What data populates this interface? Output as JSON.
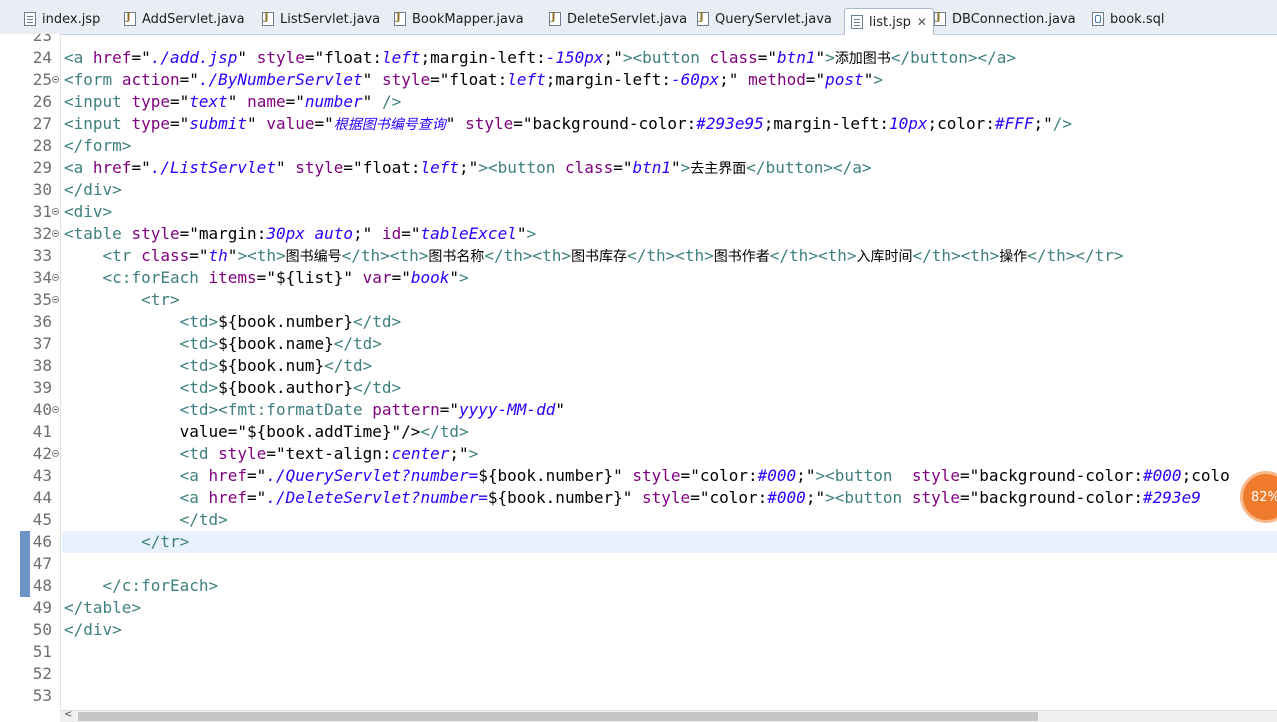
{
  "tabs": [
    {
      "label": "index.jsp",
      "icon": "jsp-file-icon",
      "kind": "jsp"
    },
    {
      "label": "AddServlet.java",
      "icon": "java-file-icon",
      "kind": "java"
    },
    {
      "label": "ListServlet.java",
      "icon": "java-file-icon",
      "kind": "java"
    },
    {
      "label": "BookMapper.java",
      "icon": "java-file-icon",
      "kind": "java"
    },
    {
      "label": "DeleteServlet.java",
      "icon": "java-file-icon",
      "kind": "java"
    },
    {
      "label": "QueryServlet.java",
      "icon": "java-file-icon",
      "kind": "java"
    },
    {
      "label": "list.jsp",
      "icon": "jsp-file-icon",
      "kind": "jsp",
      "active": true,
      "close": "✕"
    },
    {
      "label": "DBConnection.java",
      "icon": "java-file-icon",
      "kind": "java"
    },
    {
      "label": "book.sql",
      "icon": "sql-file-icon",
      "kind": "sql"
    }
  ],
  "editor": {
    "current_line": 46,
    "lines": [
      {
        "n": 23,
        "t": "",
        "fold": false
      },
      {
        "n": 24,
        "t": "<a href=\"./add.jsp\" style=\"float:left;margin-left:-150px;\"><button class=\"btn1\">添加图书</button></a>"
      },
      {
        "n": 25,
        "t": "<form action=\"./ByNumberServlet\" style=\"float:left;margin-left:-60px;\" method=\"post\">",
        "fold": true
      },
      {
        "n": 26,
        "t": "<input type=\"text\" name=\"number\" />"
      },
      {
        "n": 27,
        "t": "<input type=\"submit\" value=\"根据图书编号查询\" style=\"background-color:#293e95;margin-left:10px;color:#FFF;\"/>"
      },
      {
        "n": 28,
        "t": "</form>"
      },
      {
        "n": 29,
        "t": "<a href=\"./ListServlet\" style=\"float:left;\"><button class=\"btn1\">去主界面</button></a>"
      },
      {
        "n": 30,
        "t": "</div>"
      },
      {
        "n": 31,
        "t": "<div>",
        "fold": true
      },
      {
        "n": 32,
        "t": "<table style=\"margin:30px auto;\" id=\"tableExcel\">",
        "fold": true
      },
      {
        "n": 33,
        "t": "    <tr class=\"th\"><th>图书编号</th><th>图书名称</th><th>图书库存</th><th>图书作者</th><th>入库时间</th><th>操作</th></tr>"
      },
      {
        "n": 34,
        "t": "    <c:forEach items=\"${list}\" var=\"book\">",
        "fold": true
      },
      {
        "n": 35,
        "t": "        <tr>",
        "fold": true
      },
      {
        "n": 36,
        "t": "            <td>${book.number}</td>"
      },
      {
        "n": 37,
        "t": "            <td>${book.name}</td>"
      },
      {
        "n": 38,
        "t": "            <td>${book.num}</td>"
      },
      {
        "n": 39,
        "t": "            <td>${book.author}</td>"
      },
      {
        "n": 40,
        "t": "            <td><fmt:formatDate pattern=\"yyyy-MM-dd\"",
        "fold": true
      },
      {
        "n": 41,
        "t": "            value=\"${book.addTime}\"/></td>"
      },
      {
        "n": 42,
        "t": "            <td style=\"text-align:center;\">",
        "fold": true
      },
      {
        "n": 43,
        "t": "            <a href=\"./QueryServlet?number=${book.number}\" style=\"color:#000;\"><button  style=\"background-color:#000;colo"
      },
      {
        "n": 44,
        "t": "            <a href=\"./DeleteServlet?number=${book.number}\" style=\"color:#000;\"><button style=\"background-color:#293e9"
      },
      {
        "n": 45,
        "t": "            </td>"
      },
      {
        "n": 46,
        "t": "        </tr>",
        "mark": true
      },
      {
        "n": 47,
        "t": "",
        "mark": true
      },
      {
        "n": 48,
        "t": "    </c:forEach>",
        "mark": true
      },
      {
        "n": 49,
        "t": "</table>"
      },
      {
        "n": 50,
        "t": "</div>"
      },
      {
        "n": 51,
        "t": ""
      },
      {
        "n": 52,
        "t": ""
      },
      {
        "n": 53,
        "t": ""
      }
    ]
  },
  "scrollbar": {
    "left_arrow": "<"
  },
  "badge": {
    "text": "82%"
  },
  "colors": {
    "tag": "#3f7f7f",
    "attribute": "#7f007f",
    "string": "#2a00ff",
    "current_line": "#e8f2fe",
    "change_marker": "#6e93c7"
  }
}
